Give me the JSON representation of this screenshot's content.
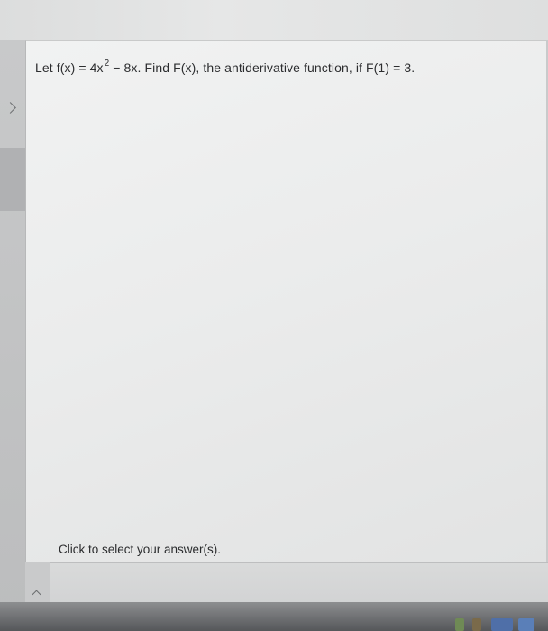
{
  "question": {
    "prefix": "Let f(x) = 4x",
    "exponent": "2",
    "suffix": " − 8x.  Find F(x), the antiderivative function, if F(1) = 3."
  },
  "answer_prompt": "Click to select your answer(s).",
  "colors": {
    "panel_bg": "#ecedee",
    "text": "#2c2d2f"
  },
  "icons": [
    "chevron-right-icon",
    "chevron-right-icon",
    "chevron-up-icon"
  ]
}
